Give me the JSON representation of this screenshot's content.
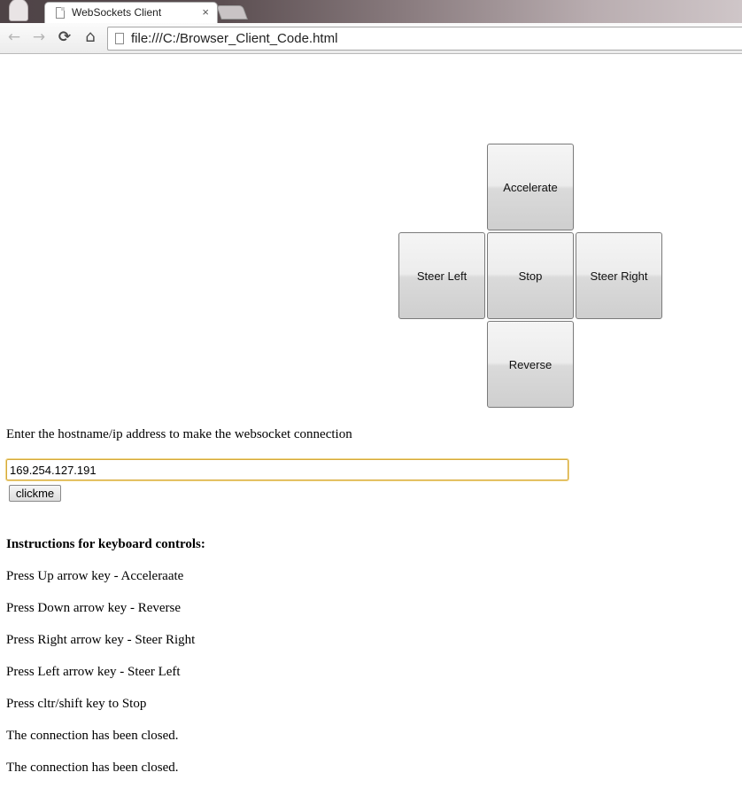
{
  "browser": {
    "tab_title": "WebSockets Client",
    "tab_close": "×",
    "url": "file:///C:/Browser_Client_Code.html"
  },
  "icons": {
    "back": "←",
    "forward": "→",
    "reload": "⟳",
    "home": "⌂"
  },
  "controls": {
    "accelerate": "Accelerate",
    "steer_left": "Steer Left",
    "stop": "Stop",
    "steer_right": "Steer Right",
    "reverse": "Reverse"
  },
  "connection": {
    "prompt": "Enter the hostname/ip address to make the websocket connection",
    "host_value": "169.254.127.191",
    "button_label": "clickme"
  },
  "instructions": {
    "heading": "Instructions for keyboard controls:",
    "items": [
      "Press Up arrow key - Acceleraate",
      "Press Down arrow key - Reverse",
      "Press Right arrow key - Steer Right",
      "Press Left arrow key - Steer Left",
      "Press cltr/shift key to Stop"
    ]
  },
  "status_messages": [
    "The connection has been closed.",
    "The connection has been closed."
  ]
}
